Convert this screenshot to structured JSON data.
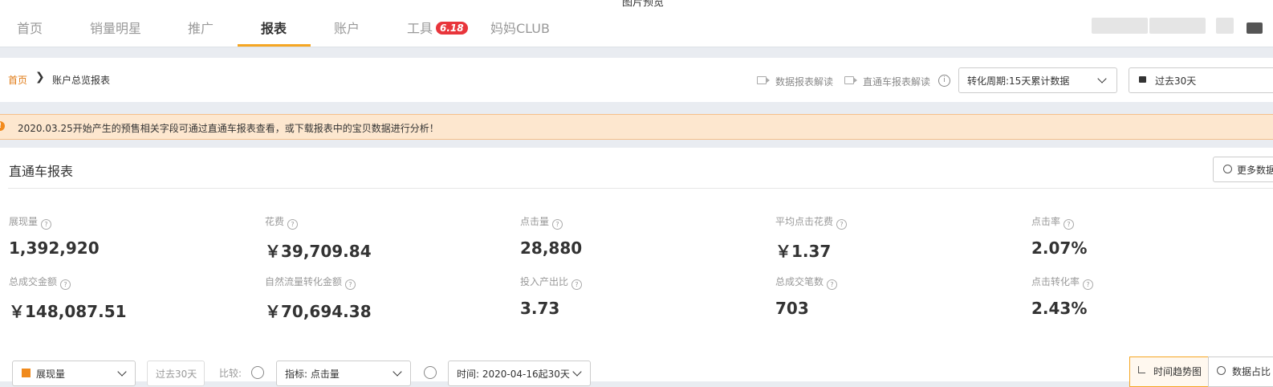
{
  "window": {
    "title": "图片预览"
  },
  "nav": {
    "items": [
      {
        "label": "首页"
      },
      {
        "label": "销量明星"
      },
      {
        "label": "推广"
      },
      {
        "label": "报表"
      },
      {
        "label": "账户"
      },
      {
        "label": "工具"
      },
      {
        "label": "妈妈CLUB"
      }
    ],
    "active": "报表",
    "badge": "6.18"
  },
  "breadcrumb": {
    "home": "首页",
    "separator": "❯",
    "current": "账户总览报表"
  },
  "toolbar": {
    "data_report_guide": "数据报表解读",
    "ztc_report_guide": "直通车报表解读",
    "conversion_period": "转化周期:15天累计数据",
    "date_range": "过去30天"
  },
  "notice": {
    "text": "2020.03.25开始产生的预售相关字段可通过直通车报表查看，或下载报表中的宝贝数据进行分析！"
  },
  "report": {
    "title": "直通车报表",
    "more_button": "更多数据",
    "metrics": [
      {
        "label": "展现量",
        "value": "1,392,920"
      },
      {
        "label": "花费",
        "value": "￥39,709.84"
      },
      {
        "label": "点击量",
        "value": "28,880"
      },
      {
        "label": "平均点击花费",
        "value": "￥1.37"
      },
      {
        "label": "点击率",
        "value": "2.07%"
      },
      {
        "label": "总成交金额",
        "value": "￥148,087.51"
      },
      {
        "label": "自然流量转化金额",
        "value": "￥70,694.38"
      },
      {
        "label": "投入产出比",
        "value": "3.73"
      },
      {
        "label": "总成交笔数",
        "value": "703"
      },
      {
        "label": "点击转化率",
        "value": "2.43%"
      }
    ]
  },
  "chart_controls": {
    "metric_select": "展现量",
    "period": "过去30天",
    "compare_label": "比较:",
    "indicator_select": "指标:  点击量",
    "time_select": "时间:  2020-04-16起30天",
    "trend_tab": "时间趋势图",
    "data_tab": "数据占比"
  },
  "colors": {
    "accent": "#f5a623",
    "notice_bg": "#fde7cf",
    "badge": "#e8353b"
  }
}
